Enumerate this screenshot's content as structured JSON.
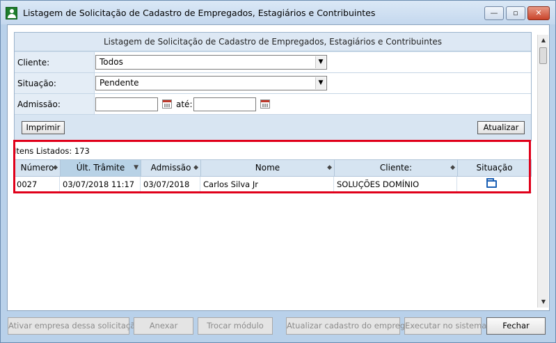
{
  "window": {
    "title": "Listagem de Solicitação de Cadastro de Empregados, Estagiários e Contribuintes",
    "min_symbol": "—",
    "max_symbol": "▫",
    "close_symbol": "✕"
  },
  "form": {
    "title": "Listagem de Solicitação de Cadastro de Empregados, Estagiários e Contribuintes",
    "cliente_label": "Cliente:",
    "cliente_value": "Todos",
    "situacao_label": "Situação:",
    "situacao_value": "Pendente",
    "admissao_label": "Admissão:",
    "admissao_from": "",
    "ate_label": "até:",
    "admissao_to": "",
    "imprimir_label": "Imprimir",
    "atualizar_label": "Atualizar"
  },
  "list": {
    "count_label": "Itens Listados: 173",
    "columns": [
      "Número",
      "Últ. Trâmite",
      "Admissão",
      "Nome",
      "Cliente:",
      "Situação"
    ],
    "rows": [
      {
        "numero": "0027",
        "ult_tramite": "03/07/2018 11:17",
        "admissao": "03/07/2018",
        "nome": "Carlos Silva Jr",
        "cliente": "SOLUÇÕES DOMÍNIO",
        "situacao_icon": "folder-icon"
      }
    ]
  },
  "footer": {
    "ativar_label": "Ativar empresa dessa solicitação",
    "anexar_label": "Anexar",
    "trocar_label": "Trocar módulo",
    "atualizar_cadastro_label": "Atualizar cadastro do empregado",
    "executar_label": "Executar no sistema",
    "fechar_label": "Fechar"
  },
  "colors": {
    "highlight": "#e0001a",
    "accent": "#1a5fb4"
  }
}
